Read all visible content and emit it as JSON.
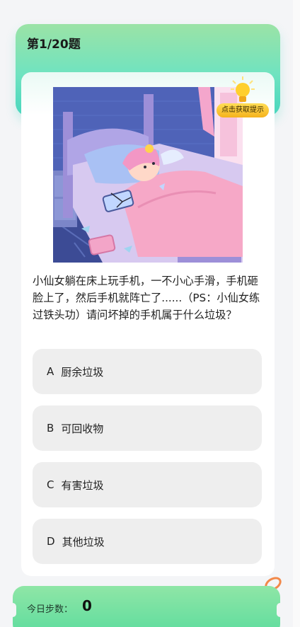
{
  "quiz": {
    "progress_title": "第1/20题",
    "question": "小仙女躺在床上玩手机，一不小心手滑，手机砸脸上了，然后手机就阵亡了......（PS：小仙女练过铁头功）请问坏掉的手机属于什么垃圾？",
    "hint_label": "点击获取提示",
    "options": [
      {
        "letter": "A",
        "text": "厨余垃圾"
      },
      {
        "letter": "B",
        "text": "可回收物"
      },
      {
        "letter": "C",
        "text": "有害垃圾"
      },
      {
        "letter": "D",
        "text": "其他垃圾"
      }
    ]
  },
  "steps": {
    "label": "今日步数：",
    "value": "0"
  },
  "icons": {
    "hint": "lightbulb-icon",
    "ring": "ring-icon"
  },
  "colors": {
    "header_gradient_top": "#9be3a6",
    "header_gradient_bottom": "#48d6be",
    "option_bg": "#eeeeee",
    "hint_button": "#f5b21c",
    "steps_bar": "#5ddc9e"
  }
}
